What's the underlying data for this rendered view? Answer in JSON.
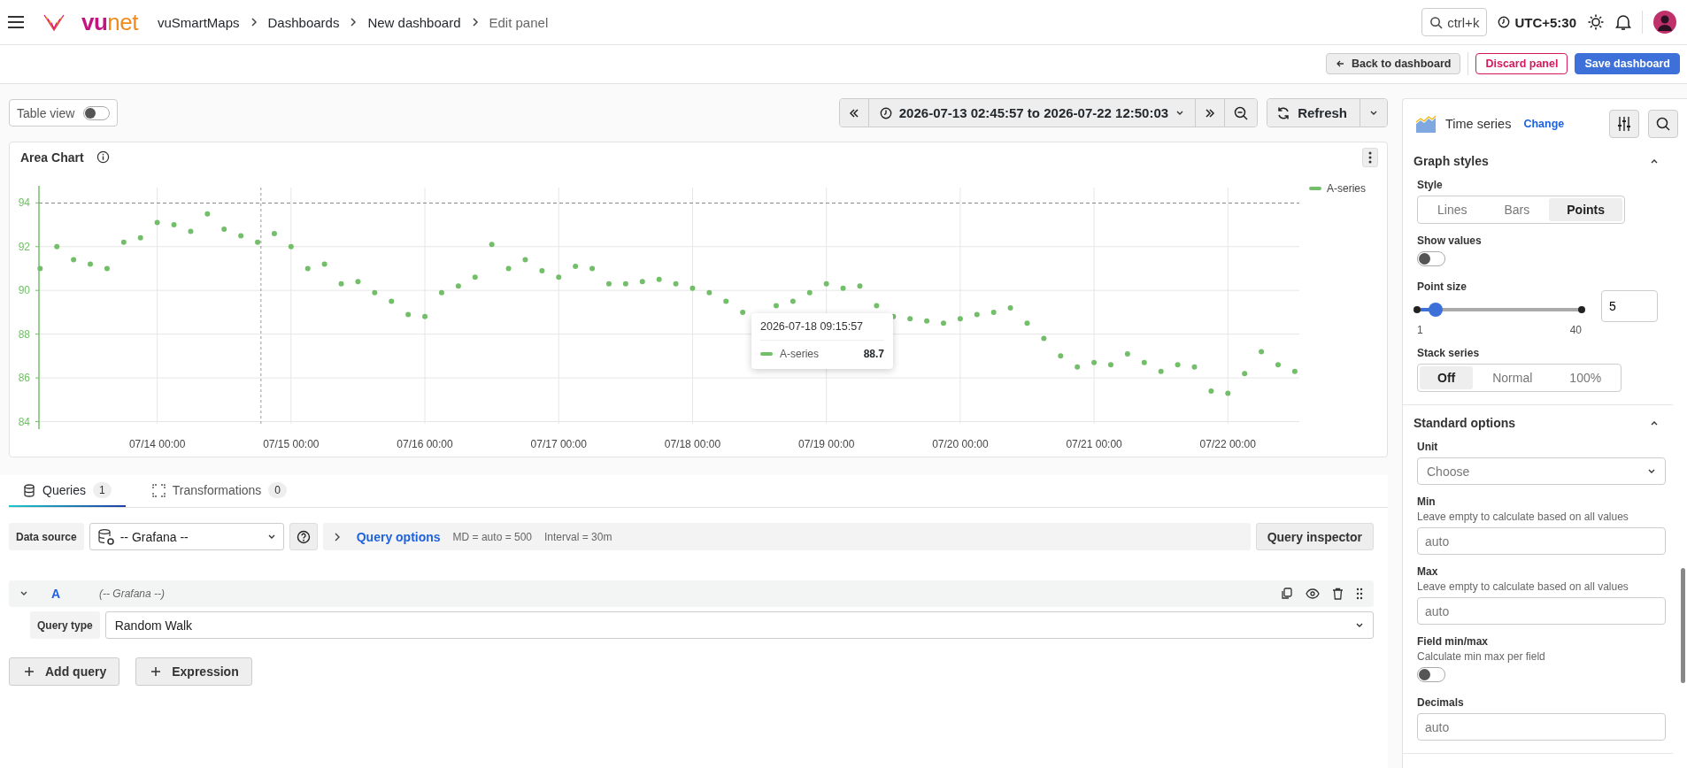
{
  "topbar": {
    "logo_text": [
      "vu",
      "net"
    ],
    "breadcrumbs": [
      "vuSmartMaps",
      "Dashboards",
      "New dashboard",
      "Edit panel"
    ],
    "search_hint": "ctrl+k",
    "timezone": "UTC+5:30"
  },
  "actions": [
    {
      "label": "Back to dashboard",
      "kind": "back"
    },
    {
      "label": "Discard panel",
      "kind": "danger"
    },
    {
      "label": "Save dashboard",
      "kind": "primary"
    }
  ],
  "table_view": {
    "label": "Table view",
    "on": false
  },
  "time_range": "2026-07-13 02:45:57 to 2026-07-22 12:50:03",
  "refresh": "Refresh",
  "panel": {
    "title": "Area Chart",
    "tooltip": {
      "time": "2026-07-18 09:15:57",
      "series": "A-series",
      "value": "88.7"
    },
    "chart_data": {
      "type": "scatter",
      "categories": [
        null,
        null,
        null,
        null,
        null,
        null,
        null,
        "07/14 00:00",
        null,
        null,
        null,
        null,
        null,
        null,
        null,
        "07/15 00:00",
        null,
        null,
        null,
        null,
        null,
        null,
        null,
        "07/16 00:00",
        null,
        null,
        null,
        null,
        null,
        null,
        null,
        "07/17 00:00",
        null,
        null,
        null,
        null,
        null,
        null,
        null,
        "07/18 00:00",
        null,
        null,
        null,
        null,
        null,
        null,
        null,
        "07/19 00:00",
        null,
        null,
        null,
        null,
        null,
        null,
        null,
        "07/20 00:00",
        null,
        null,
        null,
        null,
        null,
        null,
        null,
        "07/21 00:00",
        null,
        null,
        null,
        null,
        null,
        null,
        null,
        "07/22 00:00",
        null,
        null,
        null,
        null
      ],
      "series": [
        {
          "name": "A-series",
          "color": "#73bf69",
          "values": [
            91.0,
            92.0,
            91.4,
            91.2,
            91.0,
            92.2,
            92.4,
            93.1,
            93.0,
            92.7,
            93.5,
            92.8,
            92.5,
            92.2,
            92.6,
            92.0,
            91.0,
            91.2,
            90.3,
            90.4,
            89.9,
            89.5,
            88.9,
            88.8,
            89.9,
            90.2,
            90.6,
            92.1,
            91.0,
            91.4,
            90.9,
            90.6,
            91.1,
            91.0,
            90.3,
            90.3,
            90.4,
            90.5,
            90.3,
            90.1,
            89.9,
            89.5,
            89.0,
            null,
            89.3,
            89.5,
            89.9,
            90.3,
            90.1,
            90.2,
            89.3,
            88.8,
            88.7,
            88.6,
            88.5,
            88.7,
            88.9,
            89.0,
            89.2,
            88.5,
            87.8,
            87.0,
            86.5,
            86.7,
            86.6,
            87.1,
            86.7,
            86.3,
            86.6,
            86.5,
            85.4,
            85.3,
            86.2,
            87.2,
            86.6,
            86.3
          ]
        }
      ],
      "ylim": [
        83.9,
        94.7
      ],
      "yticks": [
        84,
        86,
        88,
        90,
        92,
        94
      ],
      "grid": true,
      "ref_lines": [
        {
          "axis": "y",
          "value": 94
        }
      ]
    }
  },
  "query_tabs": [
    {
      "label": "Queries",
      "count": "1",
      "selected": true
    },
    {
      "label": "Transformations",
      "count": "0",
      "selected": false
    }
  ],
  "data_source": {
    "label": "Data source",
    "value": "-- Grafana --"
  },
  "query_options": {
    "label": "Query options",
    "md": "MD = auto = 500",
    "interval": "Interval = 30m"
  },
  "query_inspector": "Query inspector",
  "query": {
    "name": "A",
    "source": "(-- Grafana --)",
    "expanded": true,
    "type_label": "Query type",
    "type_value": "Random Walk"
  },
  "add_buttons": [
    "Add query",
    "Expression"
  ],
  "viz": {
    "name": "Time series",
    "change": "Change"
  },
  "sections": [
    {
      "title": "Graph styles",
      "expanded": true,
      "options": [
        {
          "kind": "segmented",
          "label": "Style",
          "choices": [
            {
              "label": "Lines",
              "selected": false
            },
            {
              "label": "Bars",
              "selected": false
            },
            {
              "label": "Points",
              "selected": true
            }
          ]
        },
        {
          "kind": "switch",
          "label": "Show values",
          "on": false
        },
        {
          "kind": "slider",
          "label": "Point size",
          "min": "1",
          "max": "40",
          "level": 0.103,
          "value": "5"
        },
        {
          "kind": "segmented",
          "label": "Stack series",
          "choices": [
            {
              "label": "Off",
              "selected": true
            },
            {
              "label": "Normal",
              "selected": false
            },
            {
              "label": "100%",
              "selected": false
            }
          ]
        }
      ]
    },
    {
      "title": "Standard options",
      "expanded": true,
      "options": [
        {
          "kind": "select",
          "label": "Unit",
          "placeholder": "Choose"
        },
        {
          "kind": "input",
          "label": "Min",
          "description": "Leave empty to calculate based on all values",
          "placeholder": "auto"
        },
        {
          "kind": "input",
          "label": "Max",
          "description": "Leave empty to calculate based on all values",
          "placeholder": "auto"
        },
        {
          "kind": "switch",
          "label": "Field min/max",
          "description": "Calculate min max per field",
          "on": false
        },
        {
          "kind": "input",
          "label": "Decimals",
          "placeholder": "auto"
        }
      ]
    }
  ]
}
